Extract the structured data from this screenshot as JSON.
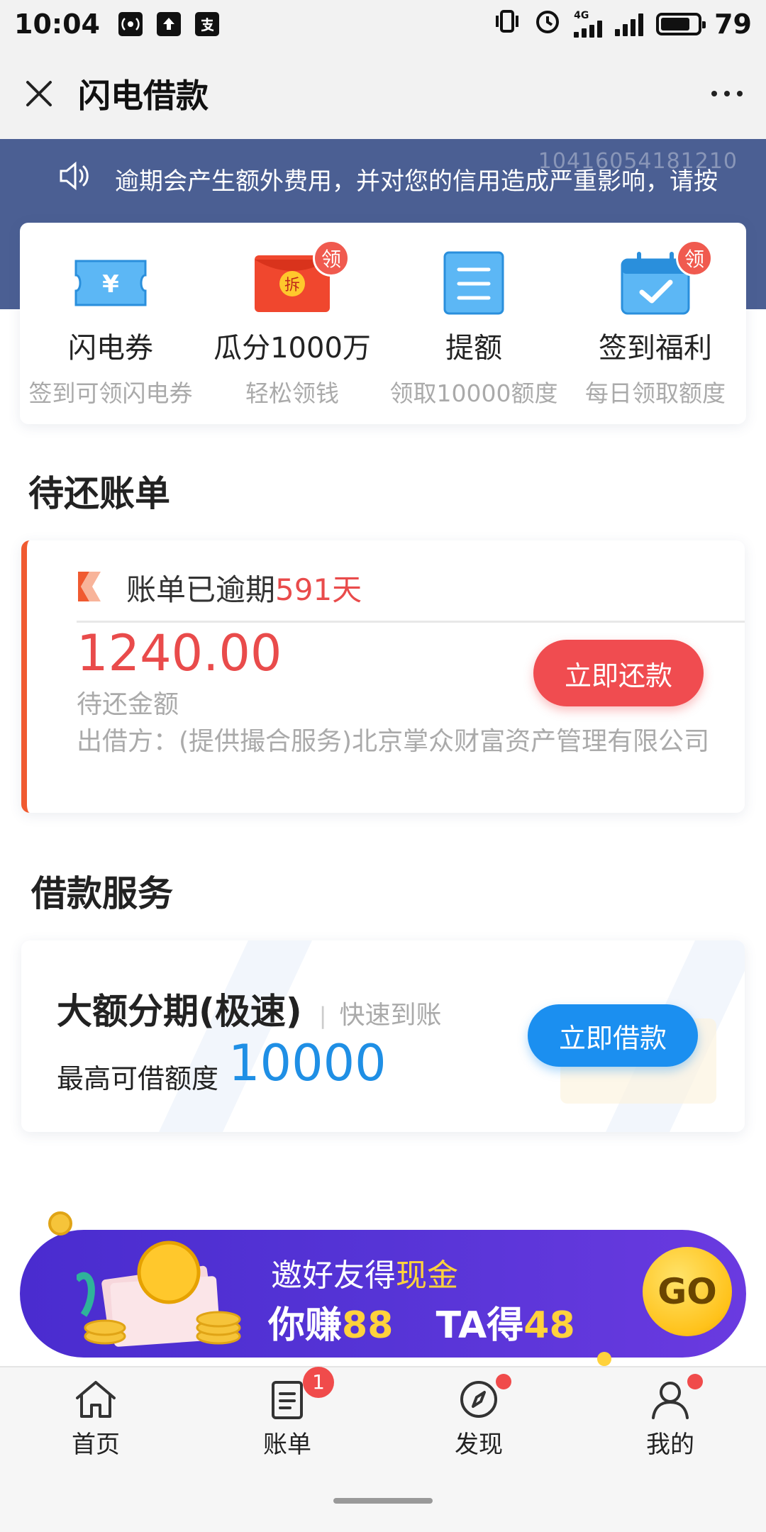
{
  "status_bar": {
    "time": "10:04",
    "battery": "79",
    "network": "4G",
    "left_icons": [
      "signal-app-icon",
      "upload-icon",
      "alipay-icon"
    ],
    "right_icons": [
      "vibrate-icon",
      "alarm-icon",
      "cell-signal-icon",
      "wifi-signal-icon",
      "battery-icon"
    ]
  },
  "title_bar": {
    "title": "闪电借款",
    "close_icon": "close-icon",
    "more_icon": "more-icon"
  },
  "notice": {
    "text": "逾期会产生额外费用，并对您的信用造成严重影响，请按",
    "watermark": "104160541812​10"
  },
  "quick_actions": [
    {
      "label": "闪电券",
      "sub": "签到可领闪电券",
      "icon": "ticket-icon",
      "badge": ""
    },
    {
      "label": "瓜分1000万",
      "sub": "轻松领钱",
      "icon": "red-envelope-icon",
      "badge": "领",
      "envelope_text": "拆"
    },
    {
      "label": "提额",
      "sub": "领取10000额度",
      "icon": "document-icon",
      "badge": ""
    },
    {
      "label": "签到福利",
      "sub": "每日领取额度",
      "icon": "calendar-check-icon",
      "badge": "领"
    }
  ],
  "pending_bills": {
    "title": "待还账单",
    "status_prefix": "账单已逾期",
    "overdue_days": "591天",
    "amount": "1240.00",
    "amount_label": "待还金额",
    "lender": "出借方：(提供撮合服务)北京掌众财富资产管理有限公司",
    "repay_button": "立即还款"
  },
  "loan_services": {
    "title": "借款服务",
    "product_name": "大额分期(极速)",
    "separator": "|",
    "tag": "快速到账",
    "limit_label": "最高可借额度",
    "limit_value": "10000",
    "borrow_button": "立即借款"
  },
  "invite_banner": {
    "line1_prefix": "邀好友得",
    "line1_highlight": "现金",
    "line2_a": "你赚",
    "line2_a_num": "88",
    "line2_b": "TA得",
    "line2_b_num": "48",
    "go_button": "GO"
  },
  "bottom_nav": [
    {
      "label": "首页",
      "icon": "home-icon",
      "badge": "",
      "dot": false
    },
    {
      "label": "账单",
      "icon": "bill-icon",
      "badge": "1",
      "dot": false
    },
    {
      "label": "发现",
      "icon": "compass-icon",
      "badge": "",
      "dot": true
    },
    {
      "label": "我的",
      "icon": "profile-icon",
      "badge": "",
      "dot": true
    }
  ],
  "colors": {
    "header_blue": "#4b5f93",
    "accent_red": "#f04c50",
    "accent_blue": "#1b8ff0",
    "banner_purple": "#5634d6",
    "gold": "#ffd23c"
  }
}
